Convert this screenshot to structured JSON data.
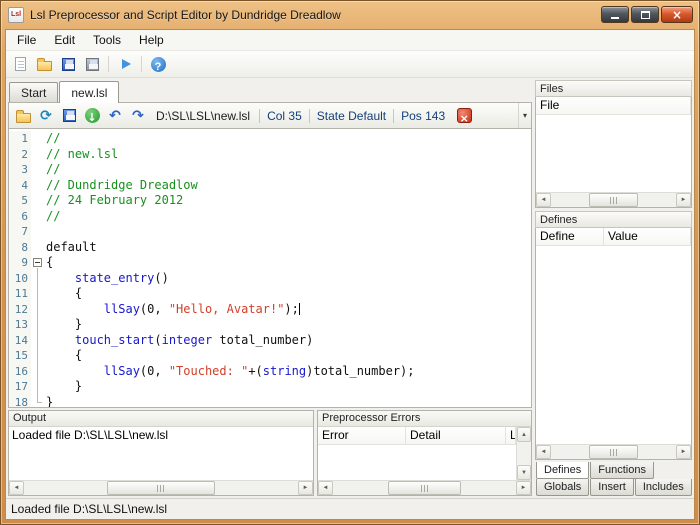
{
  "window": {
    "title": "Lsl Preprocessor and Script Editor by Dundridge Dreadlow",
    "icon_text": "Lsl"
  },
  "menu": {
    "items": [
      "File",
      "Edit",
      "Tools",
      "Help"
    ]
  },
  "toolbar": {
    "icons": [
      {
        "name": "new-file-button",
        "type": "new-file"
      },
      {
        "name": "open-file-button",
        "type": "open-folder"
      },
      {
        "name": "save-button",
        "type": "floppy-blue"
      },
      {
        "name": "save-all-button",
        "type": "floppy-gray"
      },
      {
        "name": "toolbar-separator-1",
        "type": "separator"
      },
      {
        "name": "run-button",
        "type": "play"
      },
      {
        "name": "toolbar-separator-2",
        "type": "separator"
      },
      {
        "name": "help-button",
        "type": "help"
      }
    ]
  },
  "tabs": [
    {
      "label": "Start",
      "active": false
    },
    {
      "label": "new.lsl",
      "active": true
    }
  ],
  "editor_toolbar": {
    "icons": [
      {
        "name": "open-script-button",
        "type": "open-folder"
      },
      {
        "name": "reload-script-button",
        "type": "reload"
      },
      {
        "name": "save-script-button",
        "type": "floppy-blue"
      },
      {
        "name": "fetch-script-button",
        "type": "circle-down"
      },
      {
        "name": "undo-button",
        "type": "undo"
      },
      {
        "name": "redo-button",
        "type": "redo"
      }
    ],
    "path": "D:\\SL\\LSL\\new.lsl",
    "fields": [
      {
        "name": "column-indicator",
        "label": "Col 35"
      },
      {
        "name": "state-indicator",
        "label": "State Default"
      },
      {
        "name": "position-indicator",
        "label": "Pos 143"
      }
    ]
  },
  "editor": {
    "lines": [
      {
        "n": 1,
        "tk": [
          [
            "c",
            "//"
          ]
        ]
      },
      {
        "n": 2,
        "tk": [
          [
            "c",
            "// new.lsl"
          ]
        ]
      },
      {
        "n": 3,
        "tk": [
          [
            "c",
            "//"
          ]
        ]
      },
      {
        "n": 4,
        "tk": [
          [
            "c",
            "// Dundridge Dreadlow"
          ]
        ]
      },
      {
        "n": 5,
        "tk": [
          [
            "c",
            "// 24 February 2012"
          ]
        ]
      },
      {
        "n": 6,
        "tk": [
          [
            "c",
            "//"
          ]
        ]
      },
      {
        "n": 7,
        "tk": []
      },
      {
        "n": 8,
        "tk": [
          [
            "p",
            "default"
          ]
        ]
      },
      {
        "n": 9,
        "fold": "box",
        "tk": [
          [
            "p",
            "{"
          ]
        ]
      },
      {
        "n": 10,
        "fold": "bar",
        "tk": [
          [
            "p",
            "    "
          ],
          [
            "k",
            "state_entry"
          ],
          [
            "p",
            "()"
          ]
        ]
      },
      {
        "n": 11,
        "fold": "bar",
        "tk": [
          [
            "p",
            "    {"
          ]
        ]
      },
      {
        "n": 12,
        "fold": "bar",
        "caret": true,
        "tk": [
          [
            "p",
            "        "
          ],
          [
            "k",
            "llSay"
          ],
          [
            "p",
            "(0, "
          ],
          [
            "s",
            "\"Hello, Avatar!\""
          ],
          [
            "p",
            ");"
          ]
        ]
      },
      {
        "n": 13,
        "fold": "bar",
        "tk": [
          [
            "p",
            "    }"
          ]
        ]
      },
      {
        "n": 14,
        "fold": "bar",
        "tk": [
          [
            "p",
            "    "
          ],
          [
            "k",
            "touch_start"
          ],
          [
            "p",
            "("
          ],
          [
            "k",
            "integer"
          ],
          [
            "p",
            " total_number)"
          ]
        ]
      },
      {
        "n": 15,
        "fold": "bar",
        "tk": [
          [
            "p",
            "    {"
          ]
        ]
      },
      {
        "n": 16,
        "fold": "bar",
        "tk": [
          [
            "p",
            "        "
          ],
          [
            "k",
            "llSay"
          ],
          [
            "p",
            "(0, "
          ],
          [
            "s",
            "\"Touched: \""
          ],
          [
            "p",
            "+("
          ],
          [
            "k",
            "string"
          ],
          [
            "p",
            ")total_number);"
          ]
        ]
      },
      {
        "n": 17,
        "fold": "bar",
        "tk": [
          [
            "p",
            "    }"
          ]
        ]
      },
      {
        "n": 18,
        "fold": "end",
        "tk": [
          [
            "p",
            "}"
          ]
        ]
      }
    ]
  },
  "files_panel": {
    "title": "Files",
    "columns": [
      "File"
    ]
  },
  "defines_panel": {
    "title": "Defines",
    "columns": [
      "Define",
      "Value"
    ],
    "tabs_row1": [
      "Defines",
      "Functions"
    ],
    "tabs_row2": [
      "Globals",
      "Insert",
      "Includes"
    ],
    "active_tab": "Defines"
  },
  "output_panel": {
    "title": "Output",
    "content": "Loaded file D:\\SL\\LSL\\new.lsl"
  },
  "errors_panel": {
    "title": "Preprocessor Errors",
    "columns": [
      "Error",
      "Detail",
      "Li"
    ]
  },
  "status_bar": {
    "text": "Loaded file D:\\SL\\LSL\\new.lsl"
  }
}
